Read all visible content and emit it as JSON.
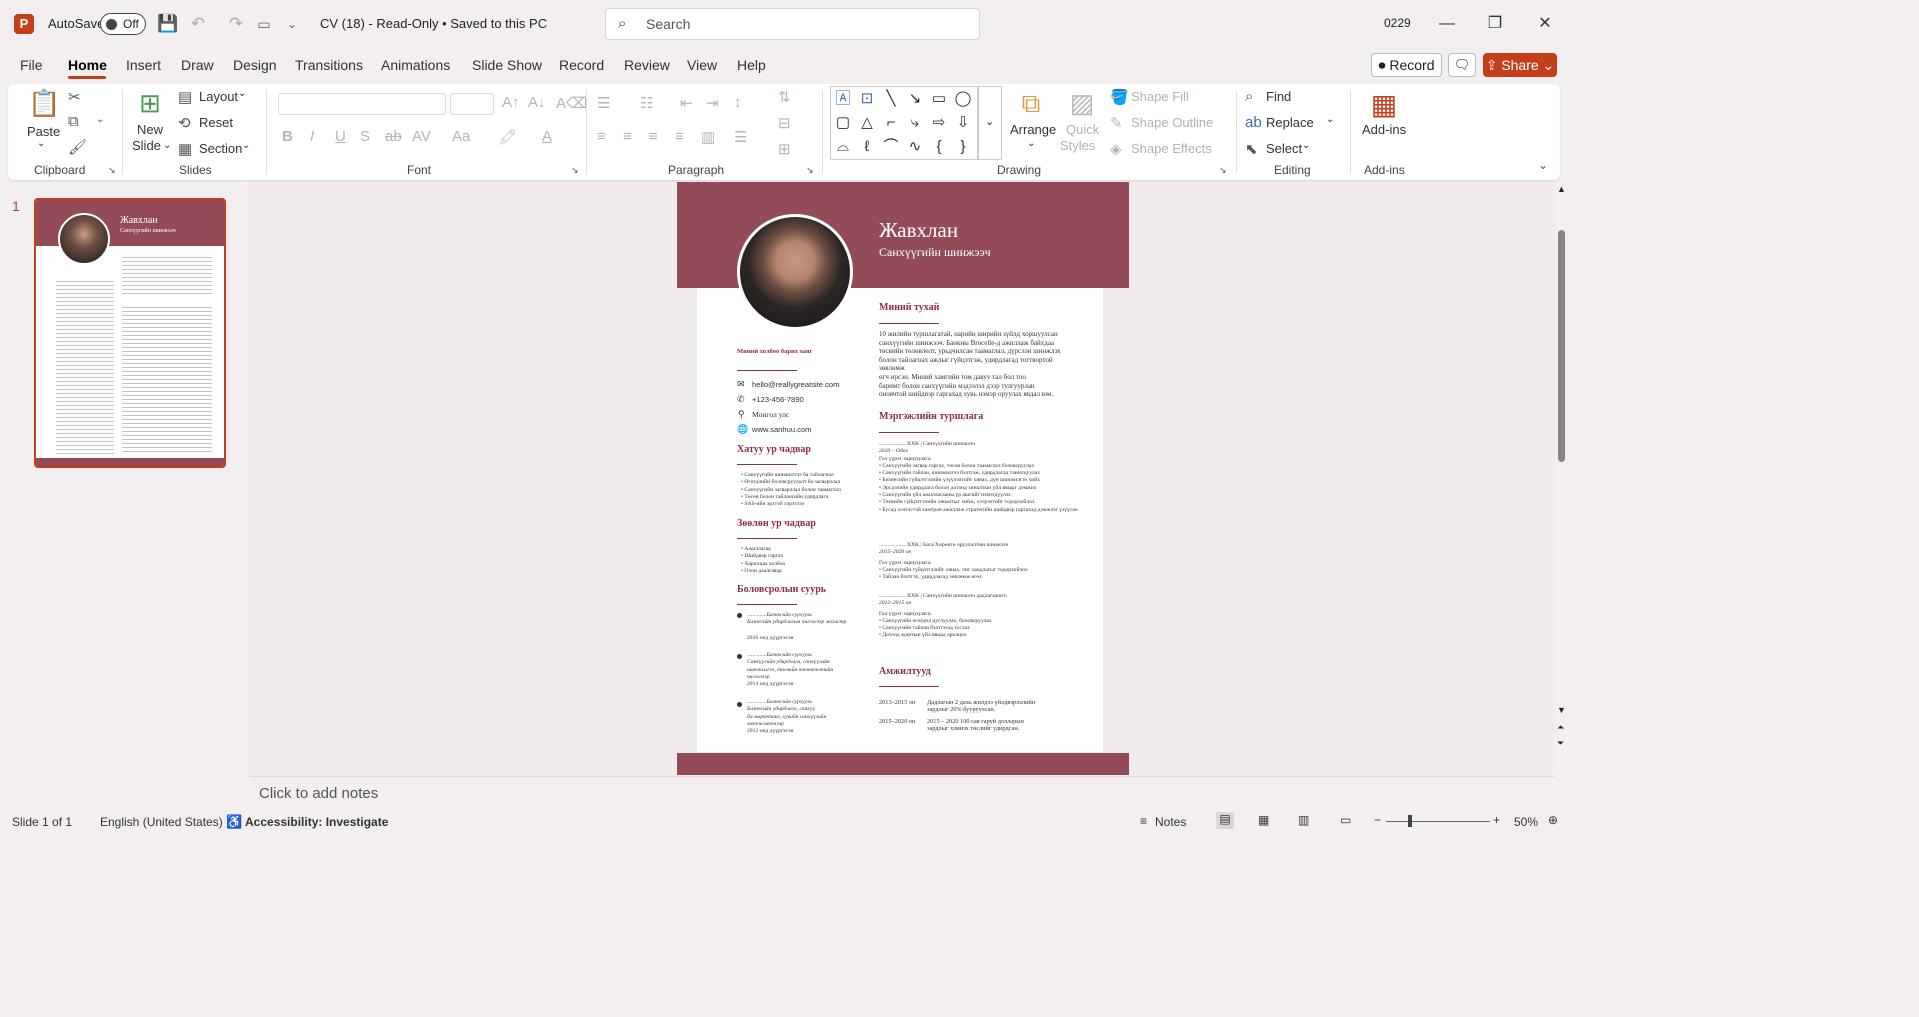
{
  "app": {
    "autosave_label": "AutoSave",
    "autosave_state": "Off",
    "doc_title": "CV (18)  -  Read-Only  •  Saved to this PC",
    "search_placeholder": "Search",
    "user": "0229",
    "colors": {
      "accent": "#c43e1c",
      "cv_brand": "#924b57",
      "cv_heading": "#8c2f3f"
    }
  },
  "menu": {
    "items": [
      "File",
      "Home",
      "Insert",
      "Draw",
      "Design",
      "Transitions",
      "Animations",
      "Slide Show",
      "Record",
      "Review",
      "View",
      "Help"
    ],
    "record": "Record",
    "share": "Share"
  },
  "ribbon": {
    "clipboard": {
      "label": "Clipboard",
      "paste": "Paste"
    },
    "slides": {
      "label": "Slides",
      "new_slide_1": "New",
      "new_slide_2": "Slide",
      "layout": "Layout",
      "reset": "Reset",
      "section": "Section"
    },
    "font": {
      "label": "Font"
    },
    "paragraph": {
      "label": "Paragraph"
    },
    "drawing": {
      "label": "Drawing",
      "arrange": "Arrange",
      "quick_styles_1": "Quick",
      "quick_styles_2": "Styles",
      "shape_fill": "Shape Fill",
      "shape_outline": "Shape Outline",
      "shape_effects": "Shape Effects"
    },
    "editing": {
      "label": "Editing",
      "find": "Find",
      "replace": "Replace",
      "select": "Select"
    },
    "addins": {
      "label": "Add-ins",
      "addins": "Add-ins"
    }
  },
  "slides_panel": {
    "number": "1"
  },
  "cv": {
    "name": "Жавхлан",
    "role": "Санхүүгийн шинжээч",
    "about_title": "Миний тухай",
    "about_text": [
      "10 жилийн туршлагатай, нарийн ширийн зүйлд хоршуулсан",
      "санхүүгийн шинжээч. Банкны Brocelle-д ажиллаж байхдаа",
      "төсвийн төлөвлөлт, урьдчилсан таамаглал, дүрслэн шинжлэх",
      "болон тайлагнах ажлыг гүйцэтгэж, удирдлагад тогтвортой зөвлөмж",
      "өгч ирсэн. Миний хамгийн том давуу тал бол тоо",
      "баримт болон санхүүгийн мэдээлэл дээр тулгуурлан",
      "оновчтой шийдвэр гаргахад хувь нэмэр оруулах явдал юм."
    ],
    "contact_title": "Миний холбоо барих хаяг",
    "contacts": [
      "hello@reallygreatsite.com",
      "+123-456-7890",
      "Монгол улс",
      "www.sanhuu.com"
    ],
    "hard_title": "Хатуу ур чадвар",
    "hard_skills": [
      "Санхүүгийн шинжилгээ ба тайлагнал",
      "Өгөгдлийн боловсруулалт ба загварчлал",
      "Санхүүгийн загварчлал болон таамаглал",
      "Төсөв болон тайлангийн удирдлага",
      "SAS-ийн эрхтэй хэрэглээ"
    ],
    "soft_title": "Зөөлөн ур чадвар",
    "soft_skills": [
      "Ажиллагаа",
      "Шийдвэр гаргах",
      "Харилцаа холбоо",
      "Олон даалгавар"
    ],
    "edu_title": "Боловсролын суурь",
    "education": [
      {
        "school": "..............Бизнесийн сургууль",
        "lines": [
          "Бизнесийн удирдлагын чиглэлээр магистр"
        ],
        "year": "2016 онд дүүргэсэн"
      },
      {
        "school": "..............Бизнесийн сургууль",
        "lines": [
          "Санхүүгийн удирдлага, санхүүгийн",
          "шинжилгээ, төсвийн төлөвлөлтийн",
          "чиглэлээр"
        ],
        "year": "2014 онд дүүргэсэн"
      },
      {
        "school": "..............Бизнесийн сургууль",
        "lines": [
          "Бизнесийн удирдлага, санхүү",
          "ба маркетинг, хувийн санхүүгийн",
          "менежментээр"
        ],
        "year": "2012 онд дүүргэсэн"
      }
    ],
    "exp_title": "Мэргэжлийн туршлага",
    "experience": [
      {
        "company": "....................XXK | Санхүүгийн шинжээч",
        "period": "2020 – Одоо",
        "duties_label": "Гол үүрэг хариуцлага:",
        "duties": [
          "Санхүүгийн загвар гаргах, төсөв болон таамаглал боловсруулах",
          "Санхүүгийн тайлан, шинжилгээ бэлтгэж, удирдлагад танилцуулах",
          "Бизнесийн гүйцэтгэлийн үзүүлэлтийг хянах, дүн шинжилгээ хийх",
          "Эрсдэлийн удирдлага болон дотоод хяналтын үйл явцыг дэмжих",
          "Санхүүгийн үйл ажиллагааны үр ашгийг нэмэгдүүлэх",
          "Төсвийн гүйцэтгэлийн хяналтыг хийж, хэтрэлтийг тодорхойлох",
          "Бусад хэлтэстэй хамтран ажиллаж стратегийн шийдвэр гаргахад дэмжлэг үзүүлэх"
        ]
      },
      {
        "company": "....................XXK | Бага/Хөрөнгө оруулалтын шинжээч",
        "period": "2015–2020 он",
        "duties_label": "Гол үүрэг хариуцлага:",
        "duties": [
          "Санхүүгийн гүйцэтгэлийг хянах, чиг хандлагыг тодорхойлох",
          "Тайлан бэлтгэх, удирдлагад зөвлөмж өгөх"
        ]
      },
      {
        "company": "....................XXK | Санхүүгийн шинжээч дадлагажигч",
        "period": "2012–2015 он",
        "duties_label": "Гол үүрэг хариуцлага:",
        "duties": [
          "Санхүүгийн өгөгдөл цуглуулах, боловсруулах",
          "Санхүүгийн тайлан бэлтгэхэд туслах",
          "Дотоод аудитын үйл явцад оролцох"
        ]
      }
    ],
    "awards_title": "Амжилтууд",
    "awards": [
      {
        "year": "2013–2015 он",
        "lines": [
          "Дадлагын 2 дахь жилдээ үйлдвэрлэлийн",
          "зардлыг 20% бууруулсан."
        ]
      },
      {
        "year": "2015–2020 он",
        "lines": [
          "2015 – 2020 100 сая гаруй долларын",
          "зардлыг хэмнэх төслийг удирдсан."
        ]
      }
    ]
  },
  "notes": {
    "placeholder": "Click to add notes"
  },
  "status": {
    "slide": "Slide 1 of 1",
    "language": "English (United States)",
    "accessibility": "Accessibility: Investigate",
    "notes": "Notes",
    "zoom": "50%"
  }
}
